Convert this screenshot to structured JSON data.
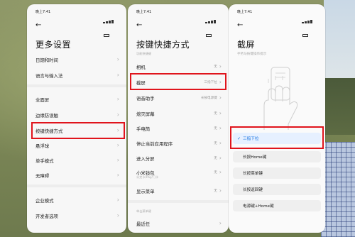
{
  "status": {
    "time": "晚上7:41"
  },
  "panel1": {
    "title": "更多设置",
    "items": [
      {
        "label": "日期和时间"
      },
      {
        "label": "语言与输入法"
      },
      {
        "label": "全面屏"
      },
      {
        "label": "边缘防误触"
      },
      {
        "label": "按键快捷方式"
      },
      {
        "label": "悬浮球"
      },
      {
        "label": "单手模式"
      },
      {
        "label": "无障碍"
      },
      {
        "label": "企业模式"
      },
      {
        "label": "开发者选项"
      }
    ]
  },
  "panel2": {
    "title": "按键快捷方式",
    "section1": "功能快捷键",
    "section2": "单击菜单键",
    "items": [
      {
        "label": "相机",
        "value": "无"
      },
      {
        "label": "截屏",
        "value": "三指下拉"
      },
      {
        "label": "语音助手",
        "value": "长按电源键"
      },
      {
        "label": "熄灭屏幕",
        "value": "无"
      },
      {
        "label": "手电筒",
        "value": "无"
      },
      {
        "label": "停止当前应用程序",
        "value": "无"
      },
      {
        "label": "进入分屏",
        "value": "无"
      },
      {
        "label": "小米钱包",
        "value": "无",
        "sub": "公交卡/Pay/门卡"
      },
      {
        "label": "显示菜单",
        "value": "无"
      },
      {
        "label": "最近任",
        "value": ""
      }
    ]
  },
  "panel3": {
    "title": "截屏",
    "hint": "手势与按键操作提示",
    "options": [
      {
        "label": "三指下拉",
        "selected": true
      },
      {
        "label": "长按Home键"
      },
      {
        "label": "长按菜单键"
      },
      {
        "label": "长按返回键"
      },
      {
        "label": "电源键+Home键"
      }
    ]
  },
  "colors": {
    "highlight": "#e0141c",
    "accent": "#0d6de0"
  },
  "icons": {
    "back": "back-arrow-icon",
    "chevron": "chevron-right-icon",
    "check": "check-icon"
  }
}
